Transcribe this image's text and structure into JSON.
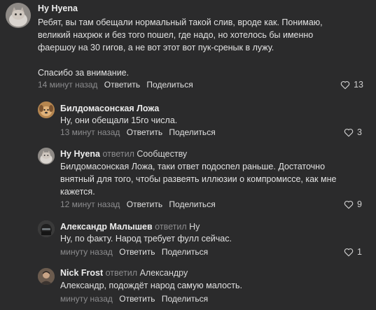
{
  "colors": {
    "background": "#2b2b2c",
    "text": "#e2e2e2",
    "muted": "#8c8c8e"
  },
  "actions": {
    "reply": "Ответить",
    "share": "Поделиться"
  },
  "comments": [
    {
      "author": "Ну Hyena",
      "replied_label": "",
      "reply_to": "",
      "text": "Ребят, вы там обещали нормальный такой слив, вроде как. Понимаю,\nвеликий нахрюк и без того пошел, где надо, но хотелось бы именно\nфаершоу на 30 гигов, а не вот этот вот пук-сренык в лужу.\n\nСпасибо за внимание.",
      "time": "14 минут назад",
      "likes": "13",
      "avatar_icon": "cat-avatar-icon"
    },
    {
      "author": "Билдомасонская Ложа",
      "replied_label": "",
      "reply_to": "",
      "text": "Ну, они обещали 15го числа.",
      "time": "13 минут назад",
      "likes": "3",
      "avatar_icon": "dog-avatar-icon"
    },
    {
      "author": "Ну Hyena",
      "replied_label": "ответил",
      "reply_to": "Сообществу",
      "text": "Билдомасонская Ложа, таки ответ подоспел раньше. Достаточно\nвнятный для того, чтобы развеять иллюзии о компромиссе, как мне\nкажется.",
      "time": "12 минут назад",
      "likes": "9",
      "avatar_icon": "cat-avatar-icon"
    },
    {
      "author": "Александр Малышев",
      "replied_label": "ответил",
      "reply_to": "Ну",
      "text": "Ну, по факту. Народ требует фулл сейчас.",
      "time": "минуту назад",
      "likes": "1",
      "avatar_icon": "helmet-avatar-icon"
    },
    {
      "author": "Nick Frost",
      "replied_label": "ответил",
      "reply_to": "Александру",
      "text": "Александр, подождёт народ самую малость.",
      "time": "минуту назад",
      "likes": "",
      "avatar_icon": "person-avatar-icon"
    }
  ]
}
